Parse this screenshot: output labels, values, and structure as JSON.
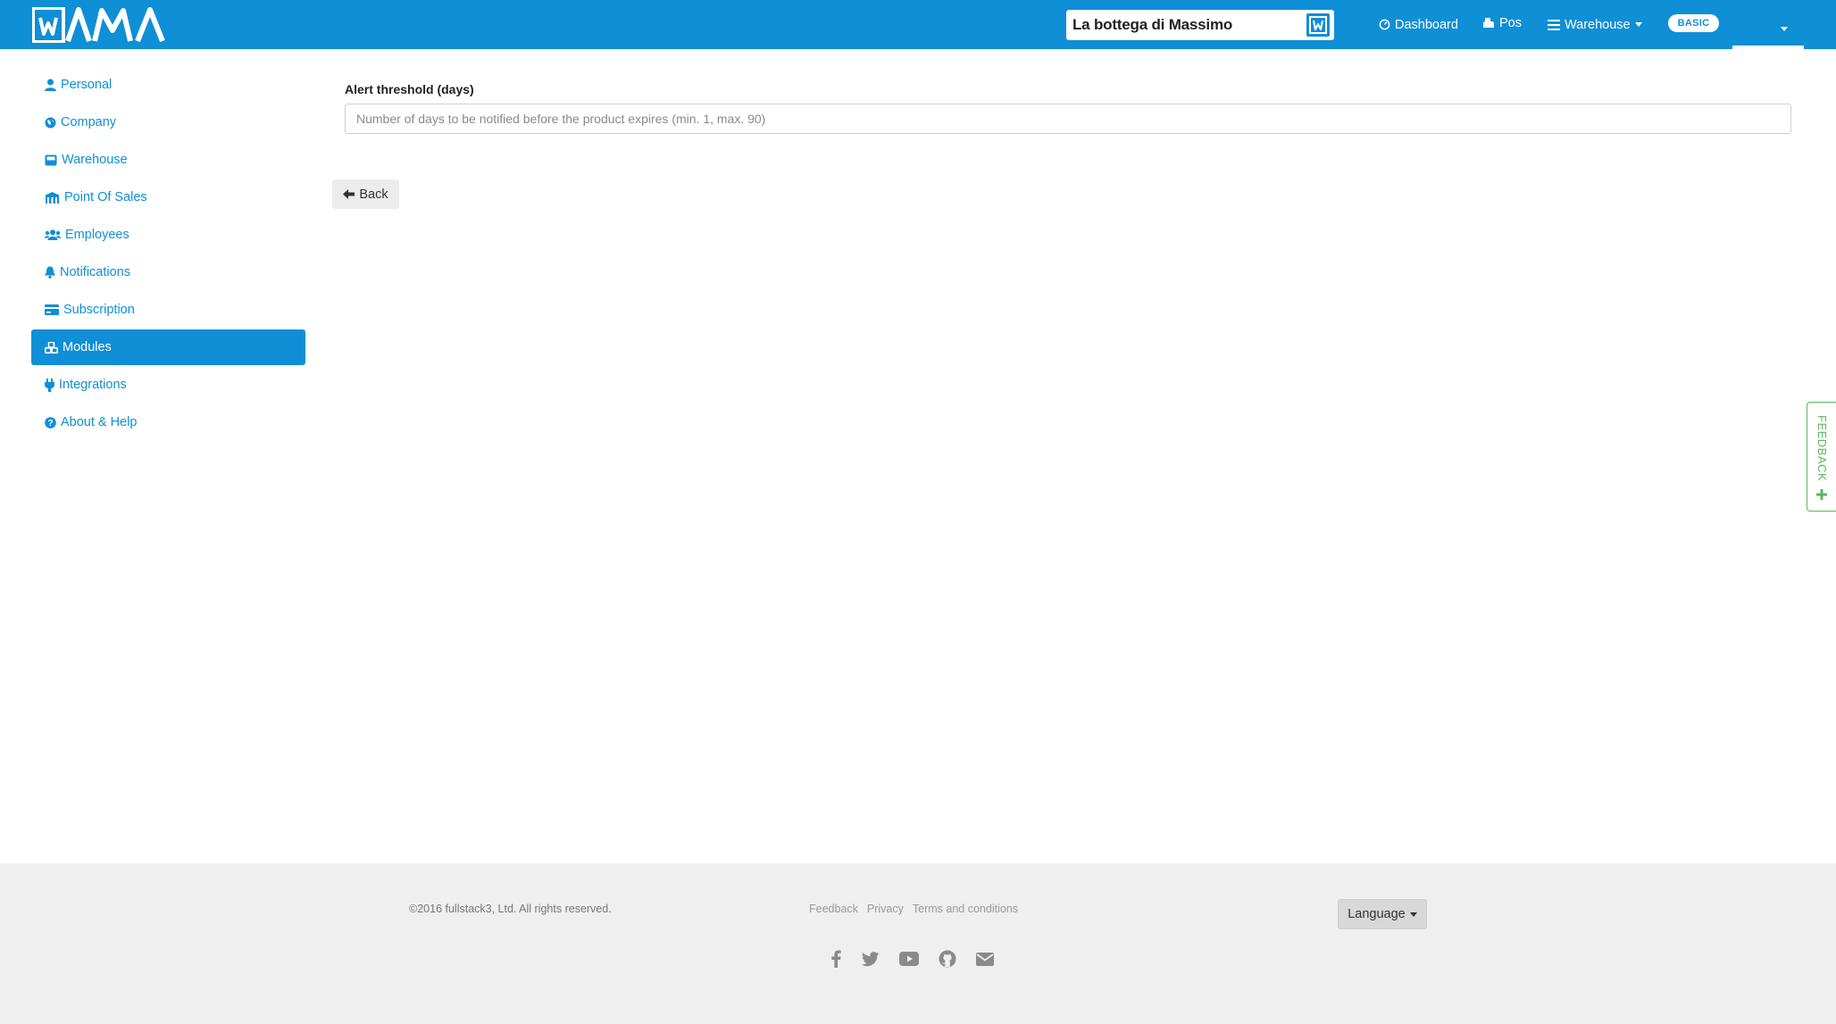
{
  "header": {
    "logo_text": "WAMA",
    "store_name": "La bottega di Massimo",
    "nav": {
      "dashboard": "Dashboard",
      "pos": "Pos",
      "warehouse": "Warehouse"
    },
    "plan_badge": "BASIC"
  },
  "sidebar": {
    "items": [
      {
        "label": "Personal",
        "icon": "user-icon"
      },
      {
        "label": "Company",
        "icon": "globe-icon"
      },
      {
        "label": "Warehouse",
        "icon": "inbox-icon"
      },
      {
        "label": "Point Of Sales",
        "icon": "store-icon"
      },
      {
        "label": "Employees",
        "icon": "users-icon"
      },
      {
        "label": "Notifications",
        "icon": "bell-icon"
      },
      {
        "label": "Subscription",
        "icon": "credit-card-icon"
      },
      {
        "label": "Modules",
        "icon": "cubes-icon",
        "active": true
      },
      {
        "label": "Integrations",
        "icon": "plug-icon"
      },
      {
        "label": "About & Help",
        "icon": "question-circle-icon"
      }
    ]
  },
  "main": {
    "field_label": "Alert threshold (days)",
    "field_value": "",
    "field_placeholder": "Number of days to be notified before the product expires (min. 1, max. 90)",
    "back_label": "Back"
  },
  "feedback_tab": "FEEDBACK",
  "footer": {
    "copyright": "©2016 fullstack3, Ltd. All rights reserved.",
    "links": [
      "Feedback",
      "Privacy",
      "Terms and conditions"
    ],
    "language_label": "Language",
    "socials": [
      "facebook-icon",
      "twitter-icon",
      "youtube-icon",
      "github-icon",
      "envelope-icon"
    ]
  },
  "colors": {
    "brand": "#0f8fd6",
    "feedback": "#5cb85c",
    "footer_bg": "#efefef"
  }
}
